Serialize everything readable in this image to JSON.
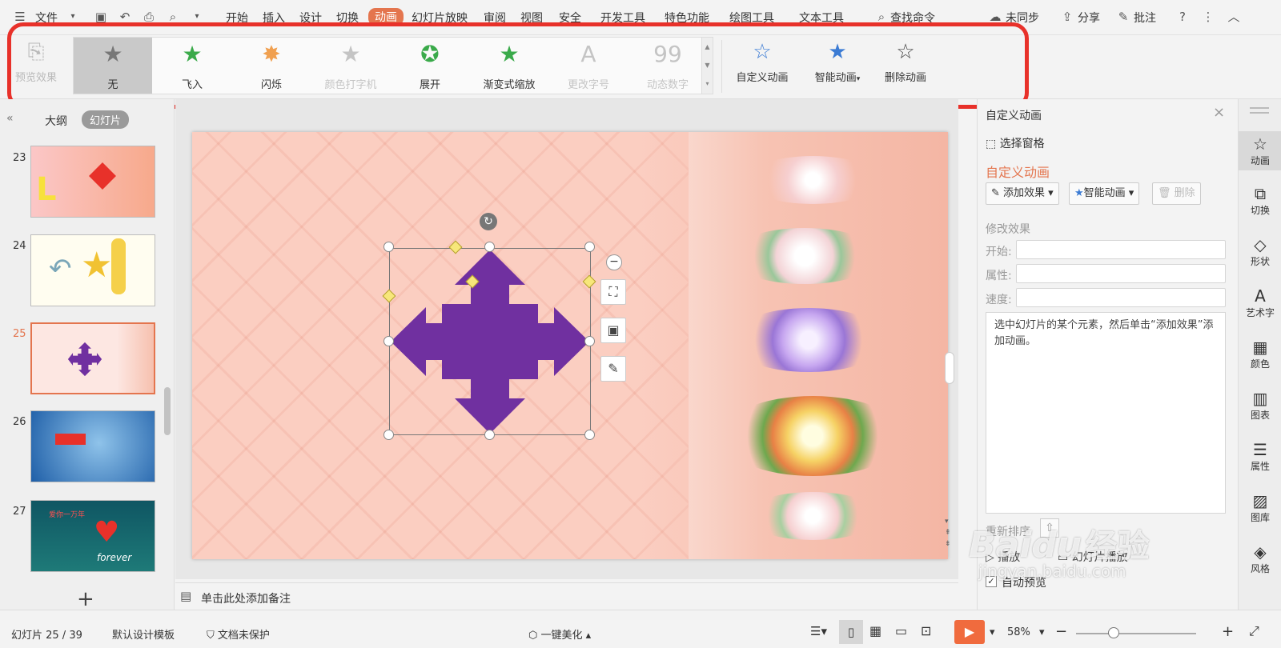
{
  "menubar": {
    "file": "文件",
    "tabs": [
      "开始",
      "插入",
      "设计",
      "切换",
      "动画",
      "幻灯片放映",
      "审阅",
      "视图",
      "安全",
      "开发工具",
      "特色功能",
      "绘图工具",
      "文本工具"
    ],
    "active_tab": "动画",
    "search": "查找命令",
    "sync": "未同步",
    "share": "分享",
    "comment": "批注"
  },
  "ribbon": {
    "preview": "预览效果",
    "effects": [
      {
        "label": "无",
        "icon": "star-gray-icon",
        "state": "selected"
      },
      {
        "label": "飞入",
        "icon": "star-flyin-icon",
        "state": "normal"
      },
      {
        "label": "闪烁",
        "icon": "star-flash-icon",
        "state": "normal"
      },
      {
        "label": "颜色打字机",
        "icon": "star-typewriter-icon",
        "state": "disabled"
      },
      {
        "label": "展开",
        "icon": "star-expand-icon",
        "state": "normal"
      },
      {
        "label": "渐变式缩放",
        "icon": "star-zoom-icon",
        "state": "normal"
      },
      {
        "label": "更改字号",
        "icon": "font-size-icon",
        "state": "disabled"
      },
      {
        "label": "动态数字",
        "icon": "dynamic-number-icon",
        "state": "disabled"
      }
    ],
    "custom_animation": "自定义动画",
    "smart_animation": "智能动画",
    "delete_animation": "删除动画"
  },
  "left_panel": {
    "tab_outline": "大纲",
    "tab_slides": "幻灯片",
    "slides": [
      {
        "num": "23",
        "active": false
      },
      {
        "num": "24",
        "active": false
      },
      {
        "num": "25",
        "active": true
      },
      {
        "num": "26",
        "active": false
      },
      {
        "num": "27",
        "active": false
      }
    ],
    "thumb27_text": "爱你一万年",
    "thumb27_forever": "forever",
    "add": "+"
  },
  "notes": {
    "placeholder": "单击此处添加备注"
  },
  "right_panel": {
    "header": "自定义动画",
    "select_pane": "选择窗格",
    "section_title": "自定义动画",
    "add_effect": "添加效果",
    "smart_animation": "智能动画",
    "delete": "删除",
    "modify": "修改效果",
    "start": "开始:",
    "property": "属性:",
    "speed": "速度:",
    "hint": "选中幻灯片的某个元素，然后单击“添加效果”添加动画。",
    "reorder": "重新排序",
    "play": "播放",
    "slideshow": "幻灯片播放",
    "auto_preview": "自动预览",
    "auto_preview_checked": true
  },
  "sidebar": [
    {
      "label": "动画",
      "icon": "star-outline-icon",
      "active": true
    },
    {
      "label": "切换",
      "icon": "switch-icon",
      "active": false
    },
    {
      "label": "形状",
      "icon": "shape-icon",
      "active": false
    },
    {
      "label": "艺术字",
      "icon": "art-text-icon",
      "active": false
    },
    {
      "label": "颜色",
      "icon": "color-grid-icon",
      "active": false
    },
    {
      "label": "图表",
      "icon": "chart-icon",
      "active": false
    },
    {
      "label": "属性",
      "icon": "sliders-icon",
      "active": false
    },
    {
      "label": "图库",
      "icon": "gallery-icon",
      "active": false
    },
    {
      "label": "风格",
      "icon": "style-icon",
      "active": false
    }
  ],
  "status": {
    "slide_info": "幻灯片 25 / 39",
    "template": "默认设计模板",
    "protect": "文档未保护",
    "beautify": "一键美化",
    "zoom": "58%"
  },
  "watermark": {
    "brand": "Baidu",
    "site": "经验",
    "url": "jingyan.baidu.com"
  },
  "colors": {
    "accent": "#e4754e",
    "shape": "#7030a0",
    "highlight": "#e8312a"
  }
}
